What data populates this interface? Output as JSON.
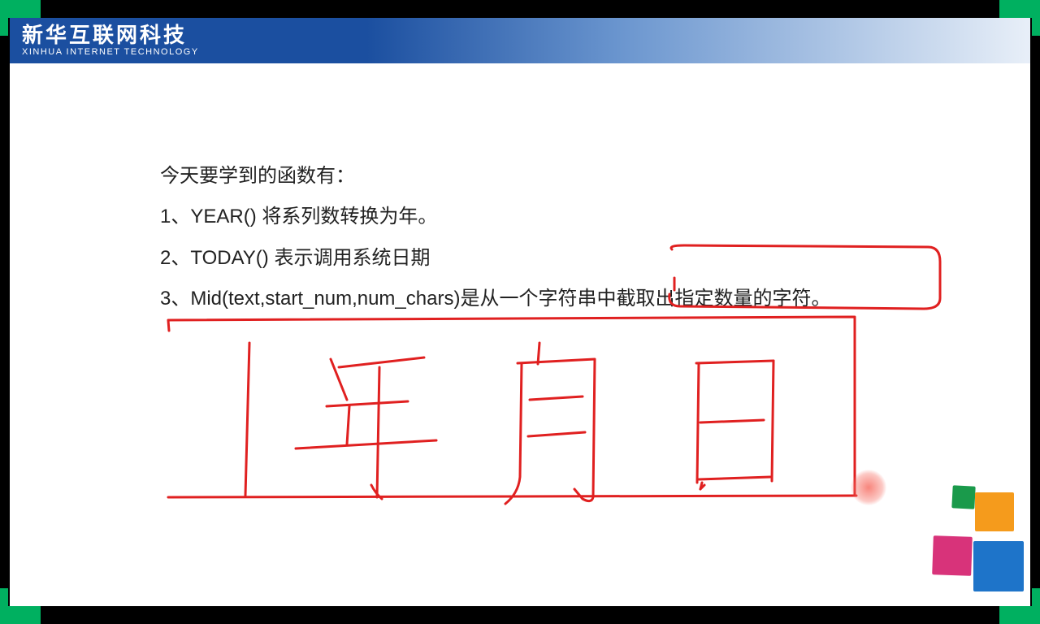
{
  "header": {
    "logo_cn": "新华互联网科技",
    "logo_en": "XINHUA INTERNET TECHNOLOGY"
  },
  "content": {
    "intro": "今天要学到的函数有：",
    "item1": "1、YEAR()  将系列数转换为年。",
    "item2": "2、TODAY()  表示调用系统日期",
    "item3": "3、Mid(text,start_num,num_chars)是从一个字符串中截取出指定数量的字符。"
  },
  "annotation": {
    "handwritten": "年 月 日",
    "stroke_color": "#e02020"
  }
}
